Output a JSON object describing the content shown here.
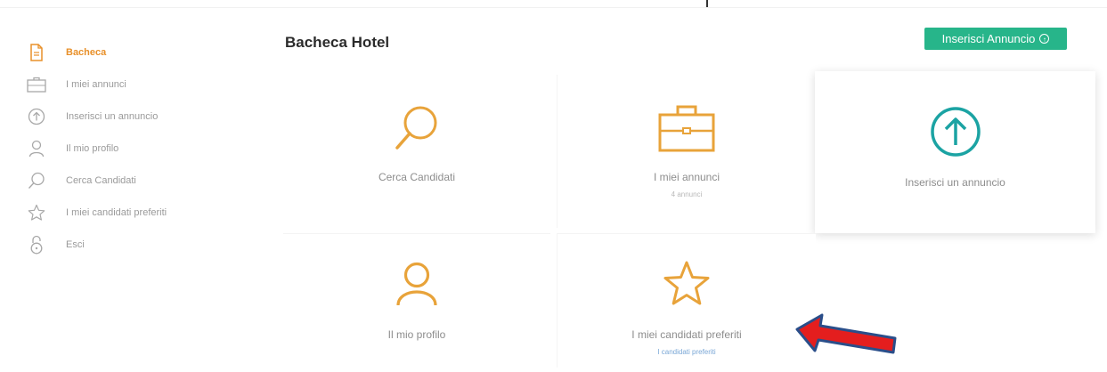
{
  "sidebar": {
    "items": [
      {
        "label": "Bacheca",
        "icon": "document-icon",
        "active": true
      },
      {
        "label": "I miei annunci",
        "icon": "briefcase-icon",
        "active": false
      },
      {
        "label": "Inserisci un annuncio",
        "icon": "upload-circle-icon",
        "active": false
      },
      {
        "label": "Il mio profilo",
        "icon": "user-icon",
        "active": false
      },
      {
        "label": "Cerca Candidati",
        "icon": "search-icon",
        "active": false
      },
      {
        "label": "I miei candidati preferiti",
        "icon": "star-icon",
        "active": false
      },
      {
        "label": "Esci",
        "icon": "padlock-icon",
        "active": false
      }
    ]
  },
  "header": {
    "title": "Bacheca Hotel",
    "add_button_label": "Inserisci Annuncio"
  },
  "tiles": [
    {
      "label": "Cerca Candidati",
      "sub": "",
      "icon": "search-icon"
    },
    {
      "label": "I miei annunci",
      "sub": "4 annunci",
      "icon": "briefcase-icon"
    },
    {
      "label": "Inserisci un annuncio",
      "sub": "",
      "icon": "upload-circle-icon"
    },
    {
      "label": "Il mio profilo",
      "sub": "",
      "icon": "user-icon"
    },
    {
      "label": "I miei candidati preferiti",
      "sub": "I candidati preferiti",
      "icon": "star-icon"
    }
  ],
  "colors": {
    "accent_orange": "#e8a33a",
    "active_orange": "#e8902a",
    "teal": "#1ba3a3",
    "button_green": "#27b58a",
    "arrow_red": "#e41e1e",
    "arrow_outline": "#2a4e8a"
  }
}
